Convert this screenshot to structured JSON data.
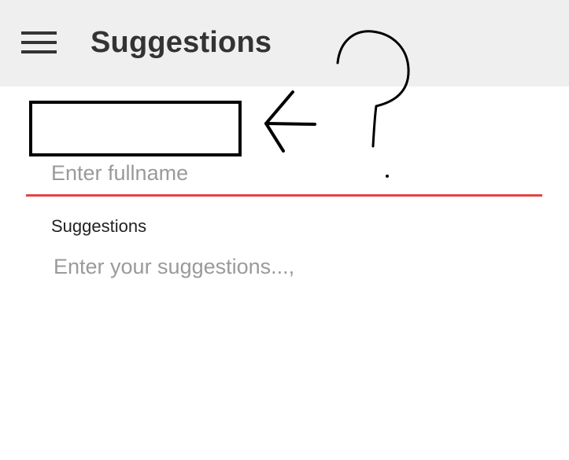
{
  "toolbar": {
    "title": "Suggestions",
    "menu_icon": "hamburger-menu-icon",
    "background": "#efefef"
  },
  "form": {
    "fullname": {
      "value": "",
      "placeholder": "Enter fullname",
      "underline_color": "#e34444"
    },
    "suggestions": {
      "label": "Suggestions",
      "value": "",
      "placeholder": "Enter your suggestions...,"
    }
  },
  "annotation": {
    "question_mark": "?",
    "arrow_icon": "arrow-left-icon"
  }
}
